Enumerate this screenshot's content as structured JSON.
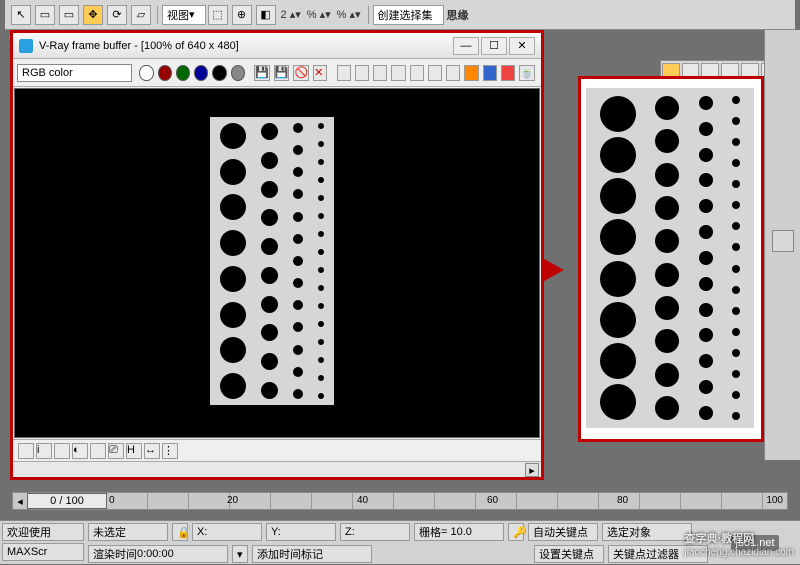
{
  "top": {
    "view_label": "视图",
    "sel_set": "创建选择集",
    "brand": "思缘"
  },
  "vfb": {
    "title": "V-Ray frame buffer - [100% of 640 x 480]",
    "channel": "RGB color",
    "min": "—",
    "max": "☐",
    "close": "✕"
  },
  "timeline": {
    "pos_label": "0 / 100",
    "t0": "0",
    "t20": "20",
    "t40": "40",
    "t60": "60",
    "t80": "80",
    "t100": "100"
  },
  "status": {
    "welcome": "欢迎使用",
    "maxscr": "MAXScr",
    "unselected": "未选定",
    "render_time": "渲染时间",
    "render_time_val": " 0:00:00",
    "x": "X:",
    "y": "Y:",
    "z": "Z:",
    "grid": "栅格",
    "grid_val": " = 10.0",
    "add_time_tag": "添加时间标记",
    "auto_key": "自动关键点",
    "set_key": "设置关键点",
    "sel_obj": "选定对象",
    "key_filter": "关键点过滤器"
  },
  "watermark": {
    "big": "查字典·教程网",
    "small": "jiaocheng.chazidian.com"
  },
  "misc": {
    "site": "jb51.net"
  }
}
